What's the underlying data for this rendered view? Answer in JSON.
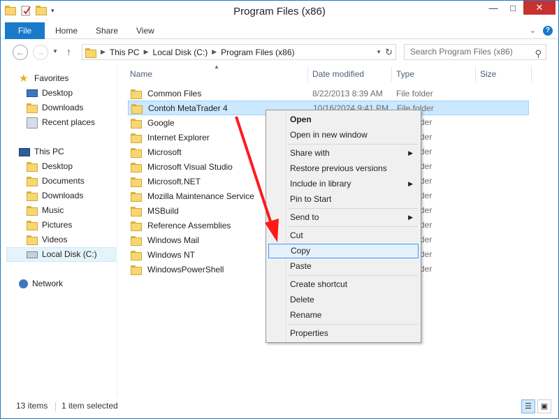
{
  "window": {
    "title": "Program Files (x86)",
    "controls": {
      "minimize": "—",
      "maximize": "□",
      "close": "✕"
    }
  },
  "ribbon": {
    "tabs": [
      "File",
      "Home",
      "Share",
      "View"
    ],
    "collapse": "⌄",
    "help": "?"
  },
  "address": {
    "crumbs": [
      "This PC",
      "Local Disk (C:)",
      "Program Files (x86)"
    ],
    "search_placeholder": "Search Program Files (x86)"
  },
  "nav": {
    "favorites": "Favorites",
    "fav_items": [
      "Desktop",
      "Downloads",
      "Recent places"
    ],
    "thispc": "This PC",
    "pc_items": [
      "Desktop",
      "Documents",
      "Downloads",
      "Music",
      "Pictures",
      "Videos",
      "Local Disk (C:)"
    ],
    "network": "Network"
  },
  "columns": [
    "Name",
    "Date modified",
    "Type",
    "Size"
  ],
  "files": [
    {
      "name": "Common Files",
      "date": "8/22/2013 8:39 AM",
      "type": "File folder"
    },
    {
      "name": "Contoh MetaTrader 4",
      "date": "10/16/2024 9:41 PM",
      "type": "File folder"
    },
    {
      "name": "Google",
      "date": "",
      "type": ""
    },
    {
      "name": "Internet Explorer",
      "date": "",
      "type": ""
    },
    {
      "name": "Microsoft",
      "date": "",
      "type": ""
    },
    {
      "name": "Microsoft Visual Studio",
      "date": "",
      "type": ""
    },
    {
      "name": "Microsoft.NET",
      "date": "",
      "type": ""
    },
    {
      "name": "Mozilla Maintenance Service",
      "date": "",
      "type": ""
    },
    {
      "name": "MSBuild",
      "date": "",
      "type": ""
    },
    {
      "name": "Reference Assemblies",
      "date": "",
      "type": ""
    },
    {
      "name": "Windows Mail",
      "date": "",
      "type": ""
    },
    {
      "name": "Windows NT",
      "date": "",
      "type": ""
    },
    {
      "name": "WindowsPowerShell",
      "date": "",
      "type": ""
    }
  ],
  "context_menu": {
    "open": "Open",
    "open_new_window": "Open in new window",
    "share_with": "Share with",
    "restore": "Restore previous versions",
    "include_library": "Include in library",
    "pin_start": "Pin to Start",
    "send_to": "Send to",
    "cut": "Cut",
    "copy": "Copy",
    "paste": "Paste",
    "create_shortcut": "Create shortcut",
    "delete": "Delete",
    "rename": "Rename",
    "properties": "Properties",
    "highlighted": "Copy"
  },
  "status": {
    "count": "13 items",
    "selected": "1 item selected"
  },
  "colors": {
    "accent": "#1979ca",
    "selection": "#cce8ff",
    "arrow": "#ff1a1a"
  }
}
